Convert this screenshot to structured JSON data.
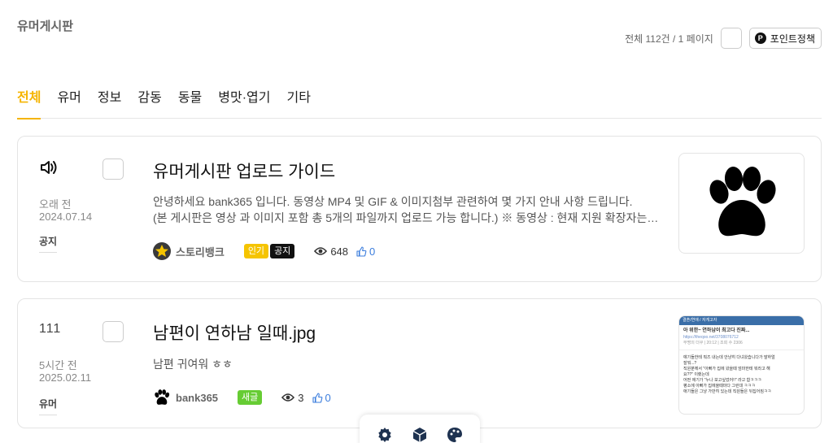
{
  "board": {
    "title": "유머게시판",
    "total": "전체 112건 / 1 페이지",
    "point_label": "포인트정책",
    "point_icon_letter": "P"
  },
  "tabs": [
    {
      "label": "전체",
      "active": true
    },
    {
      "label": "유머"
    },
    {
      "label": "정보"
    },
    {
      "label": "감동"
    },
    {
      "label": "동물"
    },
    {
      "label": "병맛·엽기"
    },
    {
      "label": "기타"
    }
  ],
  "posts": [
    {
      "icon": "speaker-icon",
      "title": "유머게시판 업로드 가이드",
      "excerpt_1": "안녕하세요 bank365 입니다. 동영상 MP4 및 GIF & 이미지첨부 관련하여 몇 가지 안내 사항 드립니다.",
      "excerpt_2": "(본 게시판은 영상 과 이미지 포함 총 5개의 파일까지 업로드 가능 합니다.)  ※ 동영상 : 현재 지원 확장자는…",
      "time_ago": "오래 전",
      "date": "2024.07.14",
      "category": "공지",
      "author": "스토리뱅크",
      "badges": [
        "인기",
        "공지"
      ],
      "views": "648",
      "likes": "0",
      "thumbnail": "paw-icon"
    },
    {
      "number": "111",
      "title": "남편이 연하남 일때.jpg",
      "excerpt_1": "남편 귀여워 ㅎㅎ",
      "time_ago": "5시간 전",
      "date": "2025.02.11",
      "category": "유머",
      "author": "bank365",
      "badges": [
        "새글"
      ],
      "views": "3",
      "likes": "0",
      "thumbnail_text": {
        "bar": "결혼/연애 / 자게고자",
        "title": "아 위한~ 연하남이 최고다 진짜...",
        "url": "https://theqoo.net/3708076712",
        "sub": "무명의 더쿠 | 20:12 | 조회 수 2306",
        "lines": [
          "얘기들한테 뭐즈 내는데 안냥히 다녀왔습니다가 말하얼",
          "잘뭐...?",
          "직원분께서 \"아빠가 집에 왔을때 엄마한테 뭐라고 해",
          "요??\" 이랬는데",
          "어떤 애기가 \"누나 보고싶었어!!\" 라고 함ㅋㅋㅋ",
          "평소에 아빠가 집에올때마다 그런대 ㅋㅋㅋ",
          "애기들은 그냥 가만히 있는데 직원들은 뒤집어짐ㅋㅋ"
        ]
      }
    }
  ],
  "fab": [
    "gear-icon",
    "cube-icon",
    "palette-icon"
  ],
  "colors": {
    "accent": "#f5b400",
    "new_badge": "#66cc33",
    "like": "#3b7ddd"
  }
}
